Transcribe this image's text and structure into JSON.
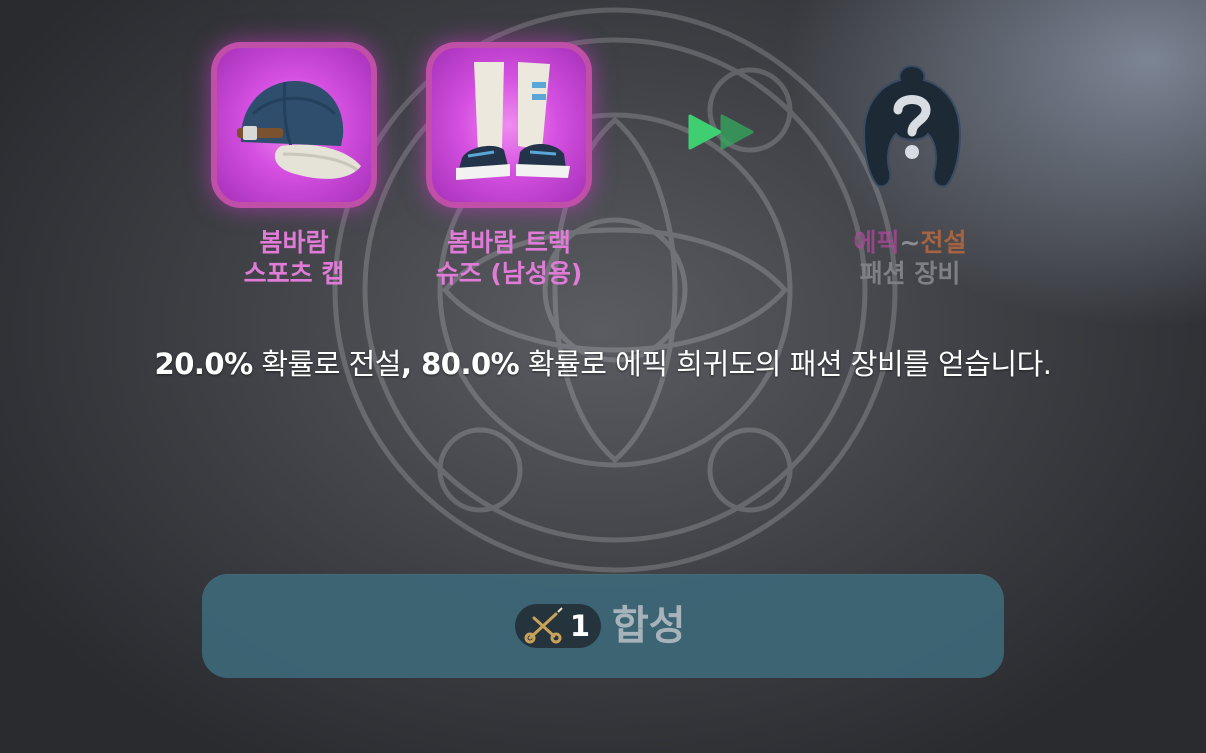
{
  "materials": [
    {
      "name": "봄바람\n스포츠 캡",
      "icon": "cap-icon"
    },
    {
      "name": "봄바람 트랙\n슈즈 (남성용)",
      "icon": "sneakers-icon"
    }
  ],
  "result": {
    "rarity_epic": "에픽",
    "rarity_sep": "~",
    "rarity_legend": "전설",
    "type": "패션 장비",
    "icon": "mystery-fashion-icon"
  },
  "description": {
    "pct_legend": "20.0%",
    "text_legend": " 확률로 전설",
    "comma": ", ",
    "pct_epic": "80.0%",
    "text_epic": " 확률로 에픽 희귀도의 패션 장비를 얻습니다."
  },
  "action": {
    "cost": "1",
    "cost_icon": "scissors-icon",
    "label": "합성"
  },
  "colors": {
    "slot_border": "#c04fa8",
    "material_label": "#e07bd7",
    "arrow": "#3fcf72",
    "button": "#3d6878"
  }
}
